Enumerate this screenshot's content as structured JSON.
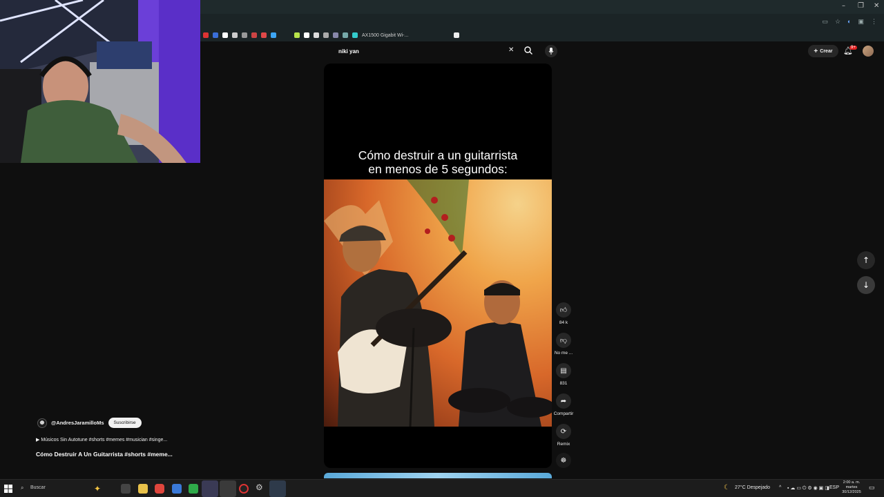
{
  "browser": {
    "bookmark_label": "AX1500 Gigabit Wi-..."
  },
  "search": {
    "query": "niki yan"
  },
  "header": {
    "create_label": "Crear",
    "notifications_badge": "9+"
  },
  "short": {
    "caption_line1": "Cómo destruir a un guitarrista",
    "caption_line2": "en menos de 5 segundos:",
    "channel": "@AndresJaramilloMs",
    "subscribe_label": "Suscribirse",
    "music": "Músicos Sin Autotune #shorts #memes #musician #singe...",
    "title": "Cómo Destruir A Un Guitarrista #shorts #meme..."
  },
  "actions": {
    "likes": "84 k",
    "dislike_label": "No me ...",
    "comments": "831",
    "share_label": "Compartir",
    "remix_label": "Remix"
  },
  "taskbar": {
    "search_placeholder": "Buscar",
    "weather": "27°C  Despejado",
    "lang": "ESP",
    "time": "2:00 a. m.",
    "day": "martes",
    "date": "30/12/2025"
  },
  "colors": {
    "accent_red": "#e02020",
    "bg": "#0f0f0f",
    "button_bg": "#272727"
  }
}
